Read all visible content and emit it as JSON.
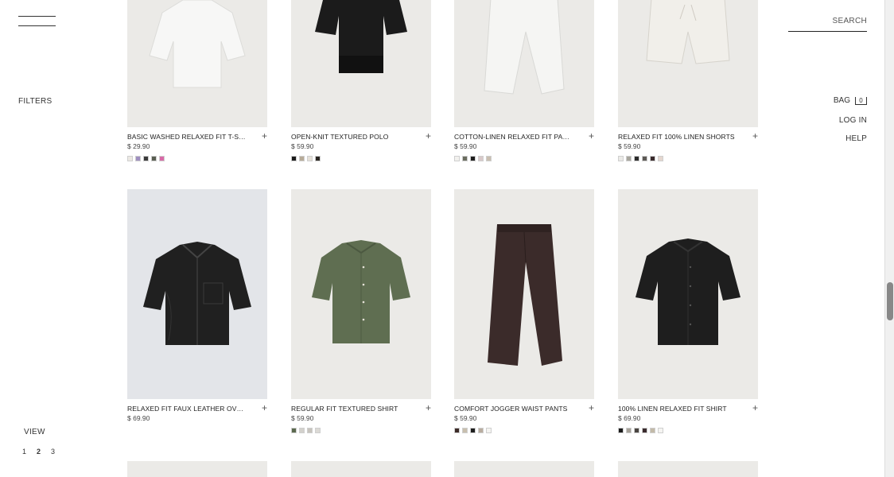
{
  "header": {
    "search_label": "SEARCH",
    "bag_label": "BAG",
    "bag_count": "0",
    "login_label": "LOG IN",
    "help_label": "HELP"
  },
  "sidebar": {
    "filters_label": "FILTERS",
    "view_label": "VIEW",
    "view_options": [
      "1",
      "2",
      "3"
    ],
    "view_selected": "2"
  },
  "products": [
    {
      "name": "BASIC WASHED RELAXED FIT T-SHIRT",
      "price": "$ 29.90",
      "image": "tshirt-white",
      "bg": "#ebeae7",
      "colors": [
        "#ece9e4",
        "#9f8fc0",
        "#3b3b3b",
        "#5a5f52",
        "#d86aa7"
      ]
    },
    {
      "name": "OPEN-KNIT TEXTURED POLO",
      "price": "$ 59.90",
      "image": "polo-black",
      "bg": "#ebeae7",
      "colors": [
        "#1c1c1c",
        "#b7ab98",
        "#e6e1d8",
        "#2a2622"
      ]
    },
    {
      "name": "COTTON-LINEN RELAXED FIT PANTS",
      "price": "$ 59.90",
      "image": "pants-white",
      "bg": "#ebeae7",
      "colors": [
        "#f2f1ee",
        "#6b6e60",
        "#1f1f1f",
        "#d9c9c9",
        "#c9bfb1"
      ]
    },
    {
      "name": "RELAXED FIT 100% LINEN SHORTS",
      "price": "$ 59.90",
      "image": "shorts-white",
      "bg": "#ebeae7",
      "colors": [
        "#ebeae7",
        "#a8a69e",
        "#2b2b2b",
        "#5d5a55",
        "#3a2a2c",
        "#e5d7cf"
      ]
    },
    {
      "name": "RELAXED FIT FAUX LEATHER OVERSHIRT",
      "price": "$ 69.90",
      "image": "shirt-leather",
      "bg": "#e3e5e9",
      "colors": []
    },
    {
      "name": "REGULAR FIT TEXTURED SHIRT",
      "price": "$ 59.90",
      "image": "shirt-green",
      "bg": "#ebeae7",
      "colors": [
        "#5c6a4f",
        "#d3d1cc",
        "#c7c4bd",
        "#dcdad6"
      ]
    },
    {
      "name": "COMFORT JOGGER WAIST PANTS",
      "price": "$ 59.90",
      "image": "pants-brown",
      "bg": "#ebeae7",
      "colors": [
        "#3d2c29",
        "#c8bfae",
        "#1f1f1f",
        "#b9ada0",
        "#f5f4f1"
      ]
    },
    {
      "name": "100% LINEN RELAXED FIT SHIRT",
      "price": "$ 69.90",
      "image": "shirt-black",
      "bg": "#ebeae7",
      "colors": [
        "#1c1c1c",
        "#a7a39a",
        "#4a4541",
        "#3a2b2d",
        "#c3baa8",
        "#f5f4f1"
      ]
    }
  ]
}
